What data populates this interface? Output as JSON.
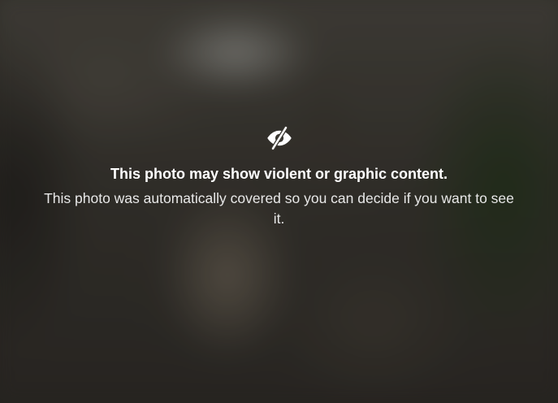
{
  "warning": {
    "icon": "eye-slash-icon",
    "heading": "This photo may show violent or graphic content.",
    "description": "This photo was automatically covered so you can decide if you want to see it."
  }
}
